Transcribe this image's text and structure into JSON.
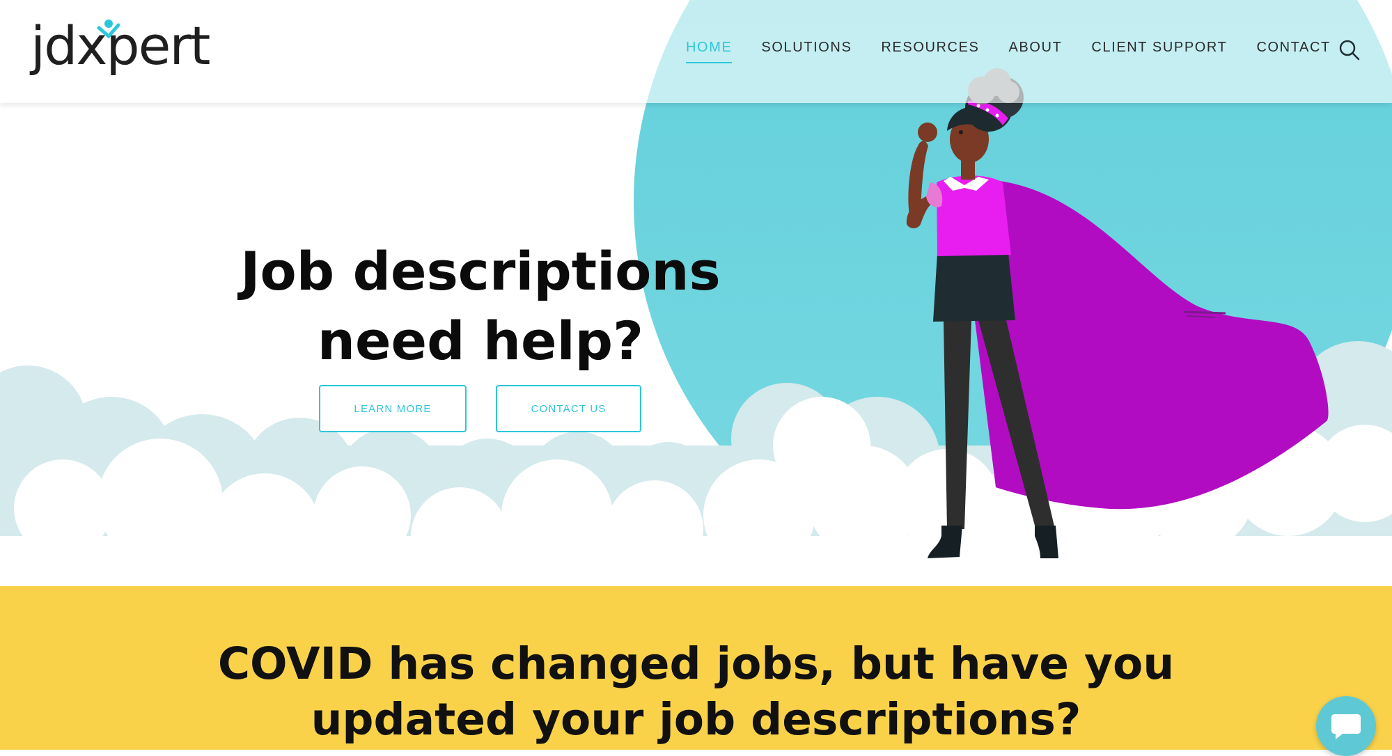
{
  "header": {
    "logo_text": "jdxpert",
    "nav": [
      {
        "label": "HOME",
        "active": true
      },
      {
        "label": "SOLUTIONS"
      },
      {
        "label": "RESOURCES"
      },
      {
        "label": "ABOUT"
      },
      {
        "label": "CLIENT SUPPORT"
      },
      {
        "label": "CONTACT"
      }
    ],
    "search_icon": "search-icon"
  },
  "hero": {
    "headline_line1": "Job descriptions",
    "headline_line2": "need help?",
    "learn_more_label": "LEARN MORE",
    "contact_us_label": "CONTACT US",
    "illustration": "superhero-woman-with-purple-cape"
  },
  "banner": {
    "heading_line1": "COVID has changed jobs, but have you",
    "heading_line2": "updated your job descriptions?"
  },
  "chat": {
    "icon": "chat-bubble-icon"
  },
  "colors": {
    "accent": "#2ec7da",
    "sky": "#63d0dc",
    "cloud_back": "#d4eaec",
    "banner_yellow": "#fad24a",
    "cape_purple": "#b20cc2",
    "shirt_magenta": "#e81ef0"
  }
}
